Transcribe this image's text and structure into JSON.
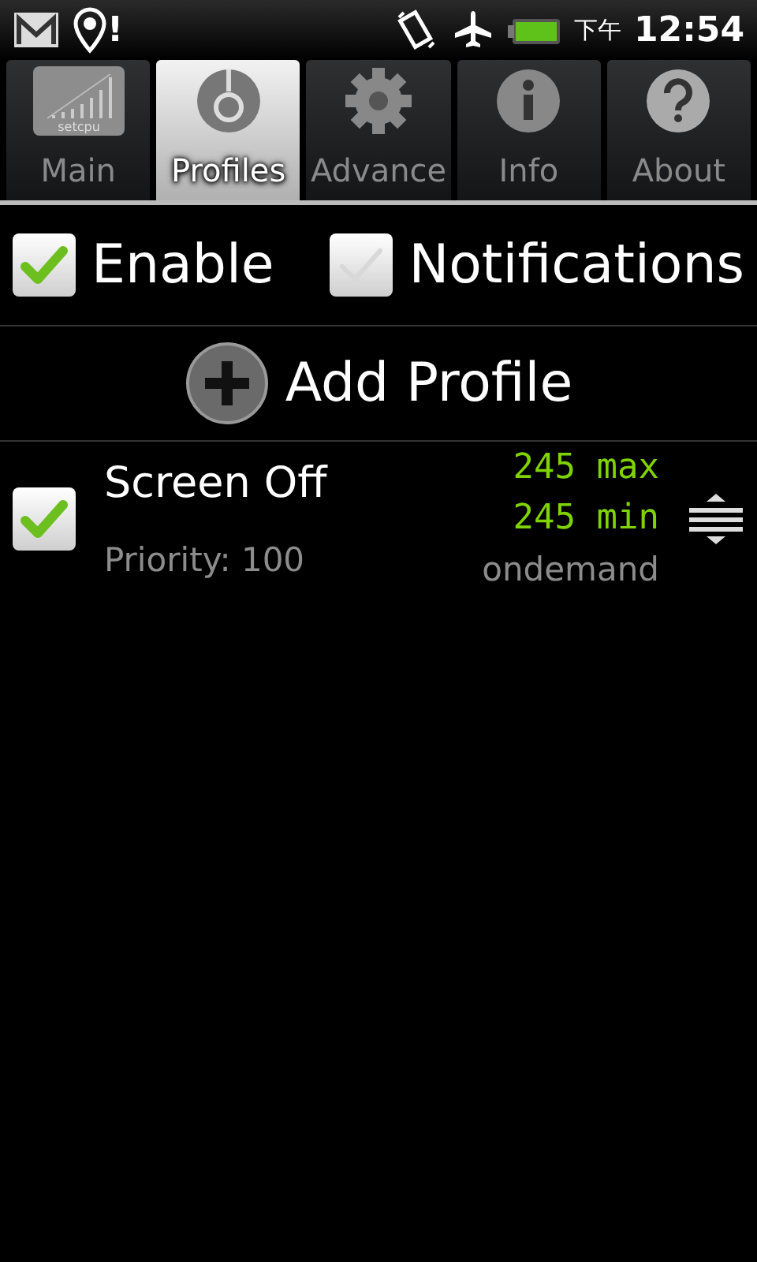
{
  "status_bar": {
    "period": "下午",
    "time": "12:54",
    "notification": "!"
  },
  "tabs": [
    {
      "label": "Main",
      "kind": "logo",
      "icon_text": "setcpu",
      "selected": false
    },
    {
      "label": "Profiles",
      "kind": "profile",
      "selected": true
    },
    {
      "label": "Advance",
      "kind": "gear",
      "selected": false
    },
    {
      "label": "Info",
      "kind": "info",
      "selected": false
    },
    {
      "label": "About",
      "kind": "help",
      "selected": false
    }
  ],
  "toggles": [
    {
      "label": "Enable",
      "checked": true
    },
    {
      "label": "Notifications",
      "checked": false
    }
  ],
  "add_button": {
    "label": "Add Profile"
  },
  "profiles": [
    {
      "name": "Screen Off",
      "checked": true,
      "priority": "Priority: 100",
      "max": "245 max",
      "min": "245 min",
      "governor": "ondemand"
    }
  ]
}
